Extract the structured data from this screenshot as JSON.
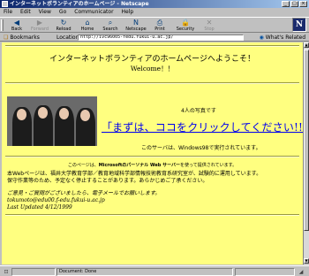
{
  "window": {
    "title": "インターネットボランティアのホームページ - Netscape",
    "controls": [
      "_",
      "□",
      "×"
    ]
  },
  "menubar": {
    "items": [
      "File",
      "Edit",
      "View",
      "Go",
      "Communicator",
      "Help"
    ]
  },
  "toolbar": {
    "buttons": [
      {
        "label": "Back",
        "glyph": "◀",
        "enabled": true
      },
      {
        "label": "Forward",
        "glyph": "▶",
        "enabled": false
      },
      {
        "label": "Reload",
        "glyph": "↻",
        "enabled": true
      },
      {
        "label": "Home",
        "glyph": "⌂",
        "enabled": true
      },
      {
        "label": "Search",
        "glyph": "⌕",
        "enabled": true
      },
      {
        "label": "Netscape",
        "glyph": "N",
        "enabled": true
      },
      {
        "label": "Print",
        "glyph": "⎙",
        "enabled": true
      },
      {
        "label": "Security",
        "glyph": "🔒",
        "enabled": true
      },
      {
        "label": "Stop",
        "glyph": "✕",
        "enabled": false
      }
    ],
    "logo": "N"
  },
  "location_bar": {
    "bookmarks_label": "Bookmarks",
    "location_label": "Location:",
    "url": "http://ivc96005-fedu.fukui-u.ac.jp/",
    "related_label": "What's Related"
  },
  "page": {
    "welcome_title": "インターネットボランティアのホームページへようこそ！",
    "welcome_sub": "Welcome！！",
    "photo_caption": "4人の写真です",
    "click_link": "「まずは、ココをクリックしてください!!」",
    "server_note": "このサーバは、Windows98で実行されています。",
    "iis_note_prefix": "このページは、",
    "iis_note_bold": "Microsoftのパーソナル Web サーバー",
    "iis_note_suffix": "を使って提供されています。",
    "desc_line1": "本Webページは、福井大学教育学部／教育地域科学部情報技術教育系研究室が、試験的に運用しています。",
    "desc_line2": "保守作業等のため、予定なく停止することがあります。あらかじめご了承ください。",
    "contact_line": "ご意見・ご質問がございましたら、電子メールでお願いします。",
    "email": "tokumoto@edu00.f-edu.fukui-u.ac.jp",
    "updated": "Last Updated 4/12/1999"
  },
  "statusbar": {
    "status": "Document: Done"
  }
}
